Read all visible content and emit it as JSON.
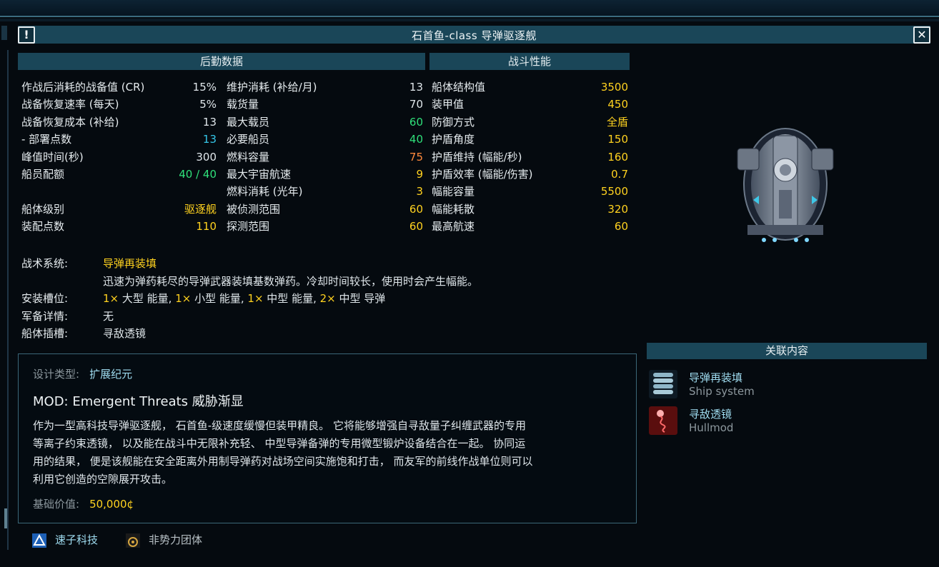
{
  "window": {
    "title": "石首鱼-class 导弹驱逐舰",
    "alert_icon": "!",
    "close_icon": "✕"
  },
  "logistics": {
    "header": "后勤数据",
    "left": [
      {
        "label": "作战后消耗的战备值 (CR)",
        "value": "15%"
      },
      {
        "label": "战备恢复速率 (每天)",
        "value": "5%"
      },
      {
        "label": "战备恢复成本 (补给)",
        "value": "13"
      },
      {
        "label": " - 部署点数",
        "value": "13"
      },
      {
        "label": "峰值时间(秒)",
        "value": "300"
      },
      {
        "label": "船员配额",
        "value": "40 / 40"
      },
      {
        "label": "",
        "value": ""
      },
      {
        "label": "船体级别",
        "value": "驱逐舰"
      },
      {
        "label": "装配点数",
        "value": "110"
      }
    ],
    "right": [
      {
        "label": "维护消耗 (补给/月)",
        "value": "13"
      },
      {
        "label": "载货量",
        "value": "70"
      },
      {
        "label": "最大载员",
        "value": "60"
      },
      {
        "label": "必要船员",
        "value": "40"
      },
      {
        "label": "燃料容量",
        "value": "75"
      },
      {
        "label": "最大宇宙航速",
        "value": "9"
      },
      {
        "label": "燃料消耗 (光年)",
        "value": "3"
      },
      {
        "label": "被侦测范围",
        "value": "60"
      },
      {
        "label": "探测范围",
        "value": "60"
      }
    ]
  },
  "combat": {
    "header": "战斗性能",
    "rows": [
      {
        "label": "船体结构值",
        "value": "3500"
      },
      {
        "label": "装甲值",
        "value": "450"
      },
      {
        "label": "防御方式",
        "value": "全盾"
      },
      {
        "label": "护盾角度",
        "value": "150"
      },
      {
        "label": "护盾维持 (幅能/秒)",
        "value": "160"
      },
      {
        "label": "护盾效率 (幅能/伤害)",
        "value": "0.7"
      },
      {
        "label": "幅能容量",
        "value": "5500"
      },
      {
        "label": "幅能耗散",
        "value": "320"
      },
      {
        "label": "最高航速",
        "value": "60"
      }
    ]
  },
  "tactical": {
    "label": "战术系统:",
    "name": "导弹再装填",
    "desc": "迅速为弹药耗尽的导弹武器装填基数弹药。冷却时间较长，使用时会产生幅能。"
  },
  "mounts": {
    "label": "安装槽位:",
    "parts": [
      {
        "count": "1×",
        "text": " 大型 能量, "
      },
      {
        "count": "1×",
        "text": " 小型 能量, "
      },
      {
        "count": "1×",
        "text": " 中型 能量, "
      },
      {
        "count": "2×",
        "text": " 中型 导弹"
      }
    ]
  },
  "armaments": {
    "label": "军备详情:",
    "value": "无"
  },
  "hullmods": {
    "label": "船体插槽:",
    "value": "寻敌透镜"
  },
  "description": {
    "design_label": "设计类型:",
    "design_value": "扩展纪元",
    "mod_line": "MOD: Emergent Threats 威胁渐显",
    "body": [
      "作为一型高科技导弹驱逐舰， 石首鱼-级速度缓慢但装甲精良。 它将能够增强自寻敌量子纠缠武器的专用",
      "等离子约束透镜， 以及能在战斗中无限补充轻、 中型导弹备弹的专用微型锻炉设备结合在一起。 协同运",
      "用的结果， 便是该舰能在安全距离外用制导弹药对战场空间实施饱和打击， 而友军的前线作战单位则可以",
      "利用它创造的空隙展开攻击。"
    ],
    "price_label": "基础价值:",
    "price_value": "50,000¢"
  },
  "factions": [
    {
      "name": "速子科技",
      "icon": "tritachyon-icon"
    },
    {
      "name": "非势力团体",
      "icon": "independent-icon"
    }
  ],
  "related": {
    "header": "关联内容",
    "items": [
      {
        "title": "导弹再装填",
        "subtitle": "Ship system",
        "icon": "missile-reload-icon"
      },
      {
        "title": "寻敌透镜",
        "subtitle": "Hullmod",
        "icon": "seeker-lens-icon"
      }
    ]
  },
  "colors": {
    "accent_bar": "#1a4658",
    "yellow": "#ffd21f",
    "green": "#2fe07a",
    "cyan": "#35c6e8",
    "orange": "#ff8a3c"
  }
}
